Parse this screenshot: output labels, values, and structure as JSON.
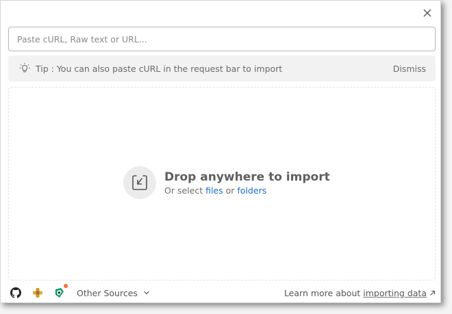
{
  "search": {
    "placeholder": "Paste cURL, Raw text or URL...",
    "value": ""
  },
  "tip": {
    "text": "Tip : You can also paste cURL in the request bar to import",
    "dismiss_label": "Dismiss",
    "icon": "lightbulb-icon"
  },
  "drop": {
    "title": "Drop anywhere to import",
    "sub_prefix": "Or select",
    "files_label": "files",
    "or_word": "or",
    "folders_label": "folders",
    "icon": "import-arrow-icon"
  },
  "footer": {
    "sources": [
      {
        "icon": "github-icon"
      },
      {
        "icon": "swagger-grid-icon"
      },
      {
        "icon": "jetbrains-icon"
      }
    ],
    "other_sources_label": "Other Sources",
    "learn_prefix": "Learn more about",
    "learn_link": "importing data"
  },
  "colors": {
    "link": "#1a6fc7",
    "notification_dot": "#ff6c37"
  }
}
